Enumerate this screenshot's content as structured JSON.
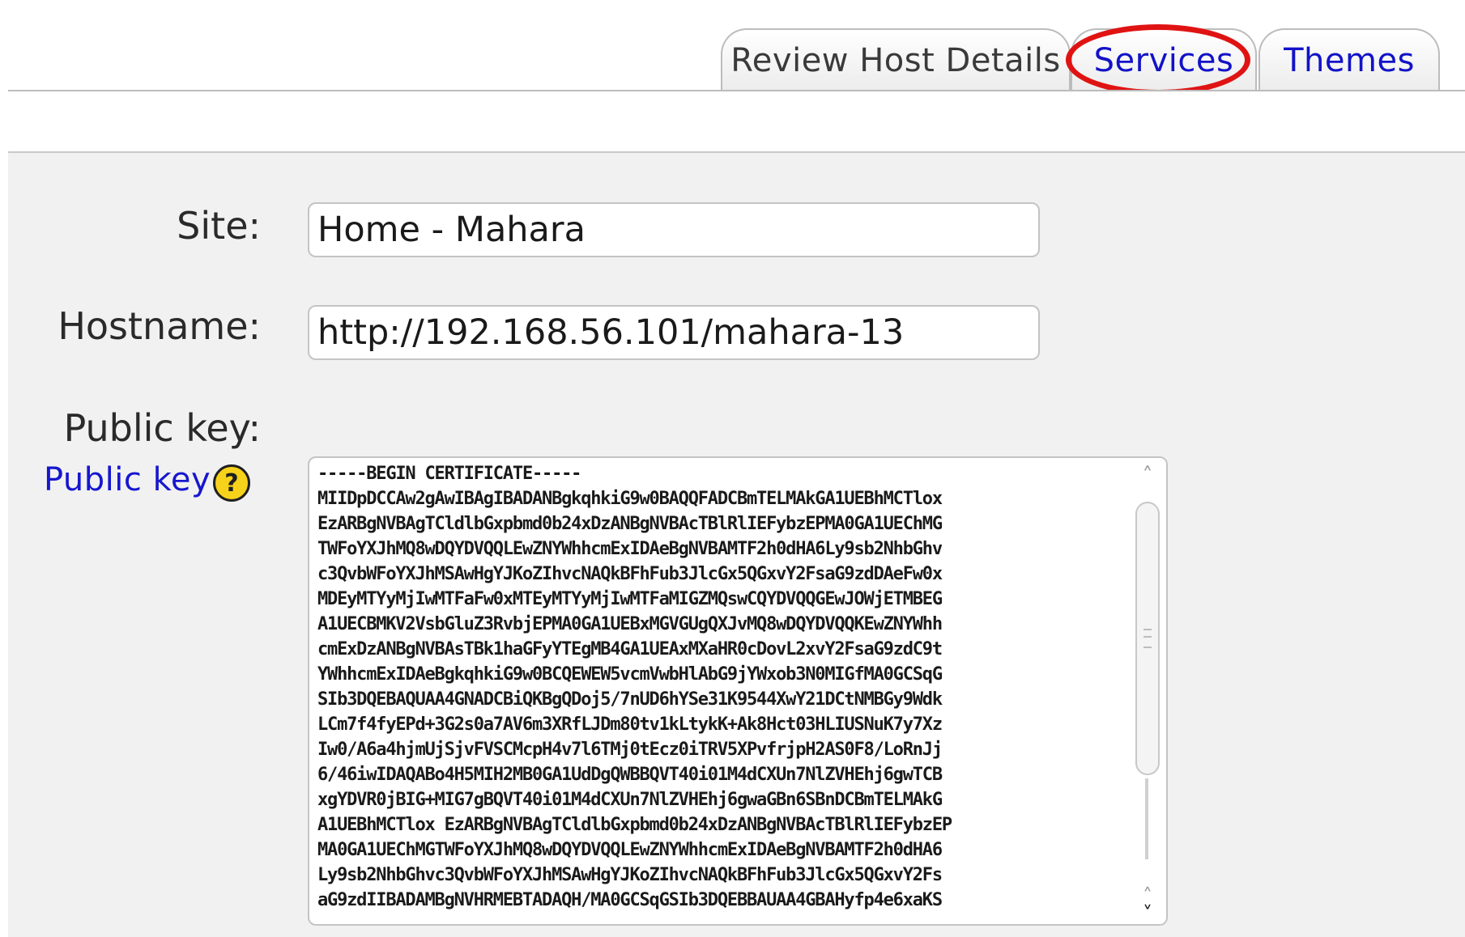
{
  "tabs": {
    "review": "Review Host Details",
    "services": "Services",
    "themes": "Themes"
  },
  "form": {
    "site_label": "Site:",
    "site_value": "Home - Mahara",
    "hostname_label": "Hostname:",
    "hostname_value": "http://192.168.56.101/mahara-13",
    "public_key_label": "Public key:",
    "help_link": "Public key",
    "help_icon_glyph": "?",
    "public_key_value": "-----BEGIN CERTIFICATE-----\nMIIDpDCCAw2gAwIBAgIBADANBgkqhkiG9w0BAQQFADCBmTELMAkGA1UEBhMCTlox\nEzARBgNVBAgTCldlbGxpbmd0b24xDzANBgNVBAcTBlRlIEFybzEPMA0GA1UEChMG\nTWFoYXJhMQ8wDQYDVQQLEwZNYWhhcmExIDAeBgNVBAMTF2h0dHA6Ly9sb2NhbGhv\nc3QvbWFoYXJhMSAwHgYJKoZIhvcNAQkBFhFub3JlcGx5QGxvY2FsaG9zdDAeFw0x\nMDEyMTYyMjIwMTFaFw0xMTEyMTYyMjIwMTFaMIGZMQswCQYDVQQGEwJOWjETMBEG\nA1UECBMKV2VsbGluZ3RvbjEPMA0GA1UEBxMGVGUgQXJvMQ8wDQYDVQQKEwZNYWhh\ncmExDzANBgNVBAsTBk1haGFyYTEgMB4GA1UEAxMXaHR0cDovL2xvY2FsaG9zdC9t\nYWhhcmExIDAeBgkqhkiG9w0BCQEWEW5vcmVwbHlAbG9jYWxob3N0MIGfMA0GCSqG\nSIb3DQEBAQUAA4GNADCBiQKBgQDoj5/7nUD6hYSe31K9544XwY21DCtNMBGy9Wdk\nLCm7f4fyEPd+3G2s0a7AV6m3XRfLJDm80tv1kLtykK+Ak8Hct03HLIUSNuK7y7Xz\nIw0/A6a4hjmUjSjvFVSCMcpH4v7l6TMj0tEcz0iTRV5XPvfrjpH2AS0F8/LoRnJj\n6/46iwIDAQABo4H5MIH2MB0GA1UdDgQWBBQVT40i01M4dCXUn7NlZVHEhj6gwTCB\nxgYDVR0jBIG+MIG7gBQVT40i01M4dCXUn7NlZVHEhj6gwaGBn6SBnDCBmTELMAkG\nA1UEBhMCTlox EzARBgNVBAgTCldlbGxpbmd0b24xDzANBgNVBAcTBlRlIEFybzEP\nMA0GA1UEChMGTWFoYXJhMQ8wDQYDVQQLEwZNYWhhcmExIDAeBgNVBAMTF2h0dHA6\nLy9sb2NhbGhvc3QvbWFoYXJhMSAwHgYJKoZIhvcNAQkBFhFub3JlcGx5QGxvY2Fs\naG9zdIIBADAMBgNVHRMEBTADAQH/MA0GCSqGSIb3DQEBBAUAA4GBAHyfp4e6xaKS"
  },
  "icons": {
    "help": "question-mark-help-icon",
    "scroll_up": "chevron-up-icon",
    "scroll_down": "chevron-down-icon"
  },
  "colors": {
    "link": "#1616cf",
    "highlight_ring": "#e01313",
    "help_icon": "#f7d21a",
    "form_background": "#f1f1f1"
  }
}
